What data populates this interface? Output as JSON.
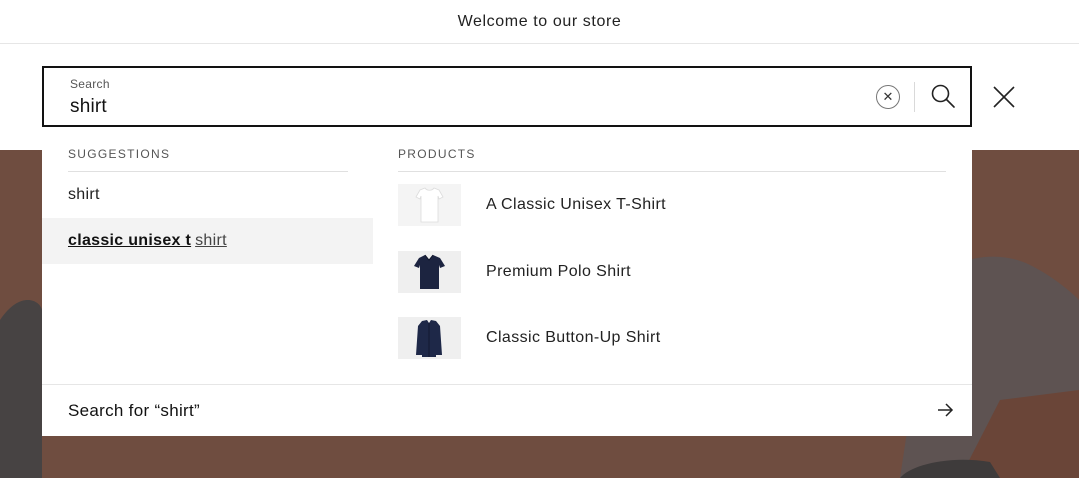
{
  "announcement": {
    "text": "Welcome to our store"
  },
  "search": {
    "label": "Search",
    "value": "shirt",
    "icons": {
      "clear": "clear-circle-icon",
      "submit": "search-icon",
      "close": "close-icon"
    }
  },
  "suggestions": {
    "heading": "SUGGESTIONS",
    "items": [
      {
        "text": "shirt",
        "bold": "",
        "rest": "shirt"
      },
      {
        "bold": "classic unisex t",
        "rest": "shirt"
      }
    ]
  },
  "products": {
    "heading": "PRODUCTS",
    "items": [
      {
        "name": "A Classic Unisex T-Shirt",
        "thumb": "white-tshirt"
      },
      {
        "name": "Premium Polo Shirt",
        "thumb": "navy-polo"
      },
      {
        "name": "Classic Button-Up Shirt",
        "thumb": "navy-button-up"
      }
    ]
  },
  "search_for": {
    "text": "Search for “shirt”",
    "icon": "arrow-right-icon"
  },
  "colors": {
    "hero": "#6e4c40",
    "border": "#121212",
    "highlight": "#f3f3f3"
  }
}
